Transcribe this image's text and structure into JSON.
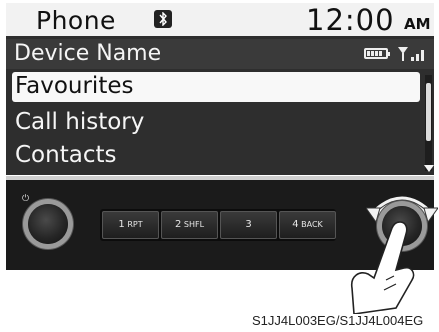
{
  "status_bar": {
    "title": "Phone",
    "bluetooth_icon": "bluetooth-icon",
    "time": "12:00",
    "ampm": "AM"
  },
  "device_row": {
    "name": "Device Name",
    "battery_icon": "battery-icon",
    "signal_icon": "signal-bars-icon"
  },
  "menu": {
    "items": [
      {
        "label": "Favourites",
        "selected": true
      },
      {
        "label": "Call history",
        "selected": false
      },
      {
        "label": "Contacts",
        "selected": false
      }
    ]
  },
  "panel": {
    "presets": [
      {
        "number": "1",
        "label": "RPT"
      },
      {
        "number": "2",
        "label": "SHFL"
      },
      {
        "number": "3",
        "label": ""
      },
      {
        "number": "4",
        "label": "BACK"
      }
    ],
    "power_icon": "power-icon"
  },
  "caption": "S1JJ4L003EG/S1JJ4L004EG",
  "colors": {
    "screen_bg": "#2e2e2e",
    "status_bg": "#f2f2f2",
    "selected_bg": "#f8f8f8",
    "panel_bg": "#1b1b1b"
  }
}
